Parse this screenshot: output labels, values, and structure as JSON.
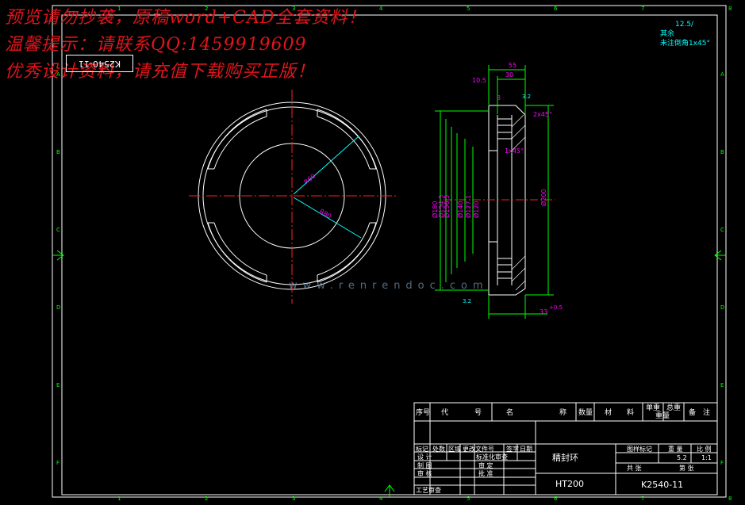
{
  "watermark": {
    "line1": "预览请勿抄袭，原稿word+CAD全套资料！",
    "line2": "温馨提示：请联系QQ:1459919609",
    "line3": "优秀设计资料，请充值下载购买正版！"
  },
  "drawing_number_box": "K2540-11",
  "logo_site": "www.renrendoc.com",
  "notes": {
    "roughness": "12.5/",
    "rest": "其余",
    "chamfer": "未注倒角1x45°"
  },
  "title_block": {
    "header": [
      "序号",
      "代",
      "号",
      "名",
      "称",
      "数量",
      "材",
      "料",
      "单重",
      "总重",
      "备",
      "注"
    ],
    "weight_header": "重量",
    "part_name": "精封环",
    "material": "HT200",
    "drawing_number": "K2540-11",
    "stage_mark": "图样标记",
    "weight_label": "重 量",
    "scale_label": "比 例",
    "weight_value": "5.2",
    "scale_value": "1:1",
    "sheet_total": "共   张",
    "sheet_no": "第   张",
    "rev_row": [
      "标记",
      "处数",
      "区域",
      "更改文件号",
      "签字",
      "日期"
    ],
    "sign_rows": [
      {
        "left": "设  计",
        "right": "标准化审查"
      },
      {
        "left": "制  图",
        "right": "审  定"
      },
      {
        "left": "审  核",
        "right": "批  准"
      },
      {
        "left": "工艺审查",
        "right": ""
      }
    ]
  },
  "dims": {
    "top_total": "55",
    "top_sub": "30",
    "left_tol": "10.5",
    "phi_labels": [
      "Ø180",
      "Ø154.5",
      "Ø156.5",
      "Ø140",
      "Ø127.1",
      "Ø120"
    ],
    "right_phi": "Ø200",
    "chamfer_a": "2x45°",
    "chamfer_b": "1x45°",
    "groove": "3",
    "bot_dim": "33",
    "bot_tol": "+0.5",
    "rough_a": "3.2",
    "rough_b": "3.2",
    "front_r1": "R60",
    "front_r2": "R80"
  },
  "border_marks": {
    "top": [
      "1",
      "2",
      "3",
      "4",
      "5",
      "6",
      "7",
      "8"
    ],
    "side": [
      "A",
      "B",
      "C",
      "D",
      "E",
      "F"
    ]
  },
  "colors": {
    "bg": "#000000",
    "line": "#ffffff",
    "center": "#ff2020",
    "dim": "#00ff00",
    "mag": "#ff00ff",
    "cyan": "#00ffff",
    "yellow": "#ffff00",
    "watermark": "#e0151b"
  }
}
